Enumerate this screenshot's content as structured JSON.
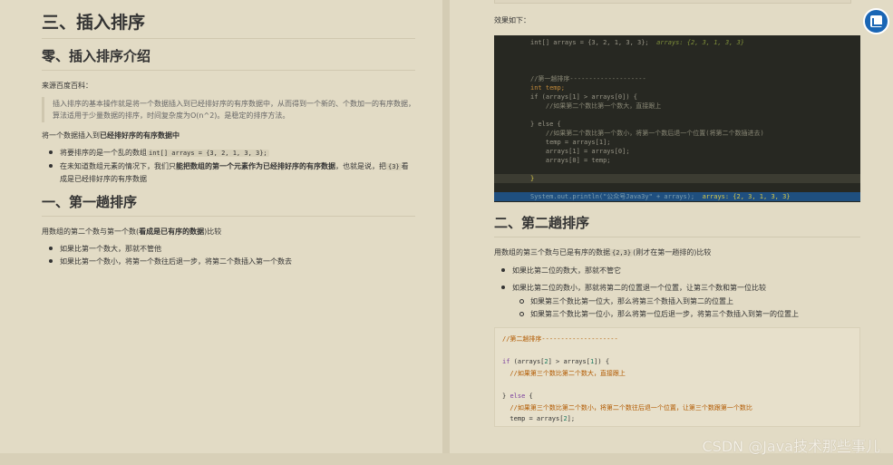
{
  "left": {
    "h1": "三、插入排序",
    "h2_intro": "零、插入排序介绍",
    "source": "来源百度百科：",
    "quote": "插入排序的基本操作就是将一个数据插入到已经排好序的有序数据中，从而得到一个新的、个数加一的有序数据，算法适用于少量数据的排序，时间复杂度为O(n^2)。是稳定的排序方法。",
    "para1_prefix": "将一个数据插入到",
    "para1_bold": "已经排好序的有序数据中",
    "bullets1": {
      "b1_prefix": "将要排序的是一个乱的数组",
      "b1_code": "int[] arrays = {3, 2, 1, 3, 3};",
      "b2_prefix": "在未知道数组元素的情况下，我们只",
      "b2_bold": "能把数组的第一个元素作为已经排好序的有序数据",
      "b2_mid": "，也就是说，把",
      "b2_code": "{3}",
      "b2_suffix": "看成是已经排好序的有序数据"
    },
    "h2_first": "一、第一趟排序",
    "para2_prefix": "用数组的第二个数与第一个数(",
    "para2_bold": "看成是已有序的数据",
    "para2_suffix": ")比较",
    "bullets2": [
      "如果比第一个数大，那就不管他",
      "如果比第一个数小，将第一个数往后退一步，将第二个数插入第一个数去"
    ]
  },
  "right": {
    "effect": "效果如下：",
    "code1": {
      "l1_code": "int[] arrays = {3, 2, 1, 3, 3};",
      "l1_hint": "arrays: {2, 3, 1, 3, 3}",
      "l2": "//第一趟排序--------------------",
      "l3": "int temp;",
      "l4": "if (arrays[1] > arrays[0]) {",
      "l5": "    //如果第二个数比第一个数大，直接跟上",
      "l6": "} else {",
      "l7": "    //如果第二个数比第一个数小，将第一个数后退一个位置(将第二个数插进去)",
      "l8": "    temp = arrays[1];",
      "l9": "    arrays[1] = arrays[0];",
      "l10": "    arrays[0] = temp;",
      "l11": "}",
      "l12_code": "System.out.println(\"公众号Java3y\" + arrays);",
      "l12_hint": "arrays: {2, 3, 1, 3, 3}"
    },
    "h2_second": "二、第二趟排序",
    "para_prefix": "用数组的第三个数与已是有序的数据",
    "para_code": "{2,3}",
    "para_suffix": "(刚才在第一趟排的)比较",
    "bullets": [
      "如果比第二位的数大，那就不管它",
      "如果比第二位的数小，那就将第二的位置退一个位置，让第三个数和第一位比较"
    ],
    "sub_bullets": [
      "如果第三个数比第一位大，那么将第三个数插入到第二的位置上",
      "如果第三个数比第一位小，那么将第一位后退一步，将第三个数插入到第一的位置上"
    ],
    "code2": {
      "l1": "//第二趟排序--------------------",
      "l2_kw": "if",
      "l2_a": " (arrays[",
      "l2_n1": "2",
      "l2_b": "] > arrays[",
      "l2_n2": "1",
      "l2_c": "]) {",
      "l3": "  //如果第三个数比第二个数大，直接跟上",
      "l4_a": "} ",
      "l4_kw": "else",
      "l4_b": " {",
      "l5": "  //如果第三个数比第二个数小，将第二个数往后退一个位置，让第三个数跟第一个数比",
      "l6_a": "  temp = arrays[",
      "l6_n": "2",
      "l6_b": "];"
    }
  },
  "watermark": "CSDN @Java技术那些事儿",
  "colors": {
    "page_bg": "#e2dbc5",
    "code_bg": "#272822",
    "fab": "#1a66b5"
  }
}
